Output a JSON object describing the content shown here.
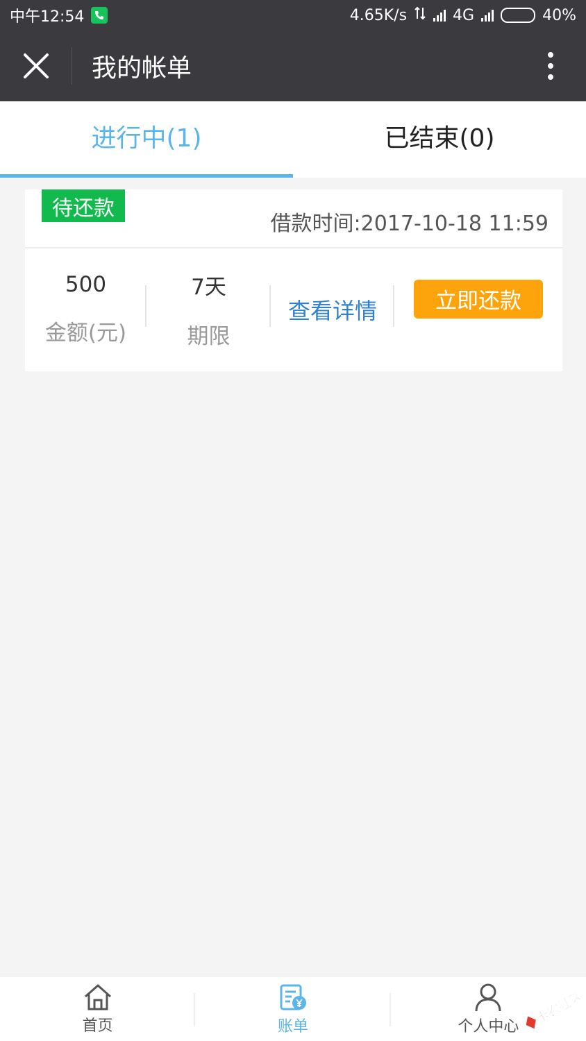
{
  "status_bar": {
    "time": "中午12:54",
    "net_speed": "4.65K/s",
    "network": "4G",
    "battery": "40%",
    "battery_level": 0.4
  },
  "header": {
    "title": "我的帐单"
  },
  "tabs": [
    {
      "label": "进行中(1)",
      "active": true
    },
    {
      "label": "已结束(0)",
      "active": false
    }
  ],
  "bill": {
    "status": "待还款",
    "loan_time": "借款时间:2017-10-18 11:59",
    "amount": "500",
    "amount_label": "金额(元)",
    "term": "7天",
    "term_label": "期限",
    "detail_label": "查看详情",
    "repay_label": "立即还款"
  },
  "bottom_nav": [
    {
      "label": "首页",
      "icon": "home-icon"
    },
    {
      "label": "账单",
      "icon": "bill-icon",
      "active": true
    },
    {
      "label": "个人中心",
      "icon": "user-icon"
    }
  ],
  "watermark": "卡农社区",
  "colors": {
    "accent": "#5ab6ea",
    "status_green": "#12b94d",
    "repay_orange": "#fda30b",
    "link_blue": "#2f80d1",
    "header_bg": "#3a3a3f"
  }
}
